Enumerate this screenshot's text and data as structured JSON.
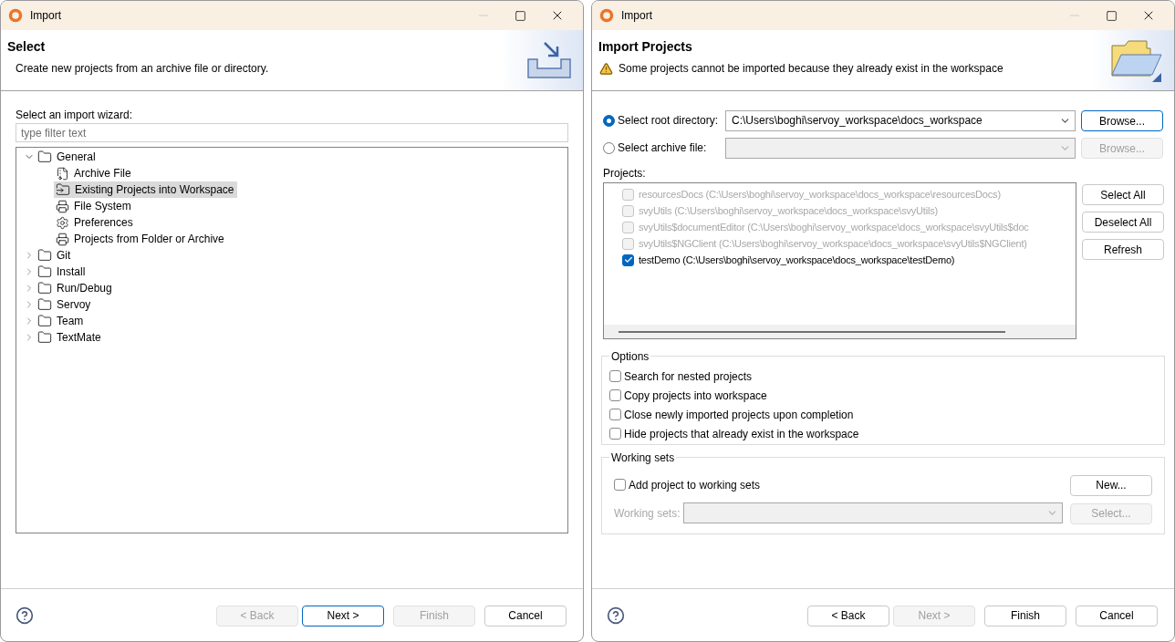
{
  "left_window": {
    "title": "Import",
    "header": {
      "title": "Select",
      "message": "Create new projects from an archive file or directory.",
      "warning": false,
      "kind": "import"
    },
    "filter_label": "Select an import wizard:",
    "filter": {
      "placeholder": "type filter text"
    },
    "tree": [
      {
        "label": "General",
        "kind": "folder",
        "expanded": true,
        "selected": false,
        "children": [
          {
            "label": "Archive File",
            "kind": "zip",
            "selected": false
          },
          {
            "label": "Existing Projects into Workspace",
            "kind": "project-folder",
            "selected": true
          },
          {
            "label": "File System",
            "kind": "drive",
            "selected": false
          },
          {
            "label": "Preferences",
            "kind": "gear",
            "selected": false
          },
          {
            "label": "Projects from Folder or Archive",
            "kind": "drive",
            "selected": false
          }
        ]
      },
      {
        "label": "Git",
        "kind": "folder",
        "expanded": false,
        "selected": false
      },
      {
        "label": "Install",
        "kind": "folder",
        "expanded": false,
        "selected": false
      },
      {
        "label": "Run/Debug",
        "kind": "folder",
        "expanded": false,
        "selected": false
      },
      {
        "label": "Servoy",
        "kind": "folder",
        "expanded": false,
        "selected": false
      },
      {
        "label": "Team",
        "kind": "folder",
        "expanded": false,
        "selected": false
      },
      {
        "label": "TextMate",
        "kind": "folder",
        "expanded": false,
        "selected": false
      }
    ],
    "buttons": [
      {
        "label": "< Back",
        "disabled": true,
        "default": false
      },
      {
        "label": "Next >",
        "disabled": false,
        "default": true
      },
      {
        "label": "Finish",
        "disabled": true,
        "default": false
      },
      {
        "label": "Cancel",
        "disabled": false,
        "default": false
      }
    ]
  },
  "right_window": {
    "title": "Import",
    "header": {
      "title": "Import Projects",
      "message": "Some projects cannot be imported because they already exist in the workspace",
      "warning": true,
      "kind": "folder"
    },
    "sources": [
      {
        "label": "Select root directory:",
        "selected": true,
        "value": "C:\\Users\\boghi\\servoy_workspace\\docs_workspace",
        "disabled": false,
        "browse": {
          "label": "Browse...",
          "disabled": false,
          "default": true
        }
      },
      {
        "label": "Select archive file:",
        "selected": false,
        "disabled": true,
        "browse": {
          "label": "Browse...",
          "disabled": true,
          "default": false
        }
      }
    ],
    "projects_label": "Projects:",
    "projects": [
      {
        "label": "resourcesDocs (C:\\Users\\boghi\\servoy_workspace\\docs_workspace\\resourcesDocs)",
        "checked": false,
        "disabled": true
      },
      {
        "label": "svyUtils (C:\\Users\\boghi\\servoy_workspace\\docs_workspace\\svyUtils)",
        "checked": false,
        "disabled": true
      },
      {
        "label": "svyUtils$documentEditor (C:\\Users\\boghi\\servoy_workspace\\docs_workspace\\svyUtils$doc",
        "checked": false,
        "disabled": true
      },
      {
        "label": "svyUtils$NGClient (C:\\Users\\boghi\\servoy_workspace\\docs_workspace\\svyUtils$NGClient)",
        "checked": false,
        "disabled": true
      },
      {
        "label": "testDemo (C:\\Users\\boghi\\servoy_workspace\\docs_workspace\\testDemo)",
        "checked": true,
        "disabled": false
      }
    ],
    "project_buttons": [
      {
        "label": "Select All",
        "disabled": false,
        "default": false
      },
      {
        "label": "Deselect All",
        "disabled": false,
        "default": false
      },
      {
        "label": "Refresh",
        "disabled": false,
        "default": false
      }
    ],
    "options": {
      "title": "Options",
      "items": [
        {
          "label": "Search for nested projects",
          "checked": false
        },
        {
          "label": "Copy projects into workspace",
          "checked": false
        },
        {
          "label": "Close newly imported projects upon completion",
          "checked": false
        },
        {
          "label": "Hide projects that already exist in the workspace",
          "checked": false
        }
      ]
    },
    "working_sets": {
      "title": "Working sets",
      "add": {
        "label": "Add project to working sets",
        "checked": false
      },
      "new_button": {
        "label": "New...",
        "disabled": false,
        "default": false
      },
      "sets_label": "Working sets:",
      "disabled": true,
      "select_button": {
        "label": "Select...",
        "disabled": true,
        "default": false
      }
    },
    "buttons": [
      {
        "label": "< Back",
        "disabled": false,
        "default": false
      },
      {
        "label": "Next >",
        "disabled": true,
        "default": false
      },
      {
        "label": "Finish",
        "disabled": false,
        "default": false
      },
      {
        "label": "Cancel",
        "disabled": false,
        "default": false
      }
    ]
  }
}
